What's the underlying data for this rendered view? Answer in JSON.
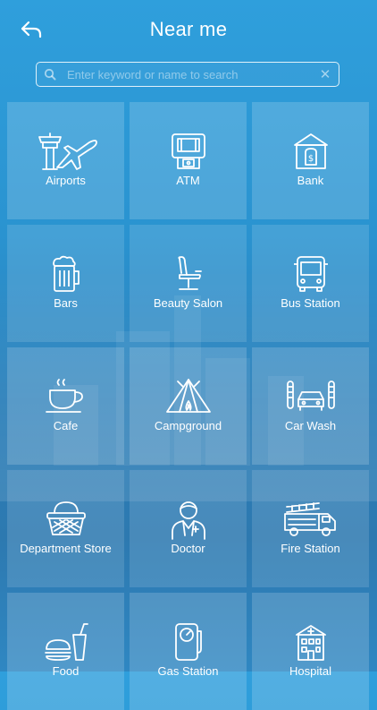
{
  "header": {
    "title": "Near me",
    "back_icon": "back-arrow-icon"
  },
  "search": {
    "placeholder": "Enter keyword or name to search",
    "value": "",
    "search_icon": "search-icon",
    "clear_label": "✕"
  },
  "categories": [
    {
      "label": "Airports",
      "icon": "airport-icon"
    },
    {
      "label": "ATM",
      "icon": "atm-icon"
    },
    {
      "label": "Bank",
      "icon": "bank-icon"
    },
    {
      "label": "Bars",
      "icon": "beer-mug-icon"
    },
    {
      "label": "Beauty Salon",
      "icon": "salon-chair-icon"
    },
    {
      "label": "Bus Station",
      "icon": "bus-icon"
    },
    {
      "label": "Cafe",
      "icon": "coffee-cup-icon"
    },
    {
      "label": "Campground",
      "icon": "tent-icon"
    },
    {
      "label": "Car Wash",
      "icon": "car-wash-icon"
    },
    {
      "label": "Department Store",
      "icon": "basket-icon"
    },
    {
      "label": "Doctor",
      "icon": "doctor-icon"
    },
    {
      "label": "Fire Station",
      "icon": "fire-truck-icon"
    },
    {
      "label": "Food",
      "icon": "fast-food-icon"
    },
    {
      "label": "Gas Station",
      "icon": "gas-pump-icon"
    },
    {
      "label": "Hospital",
      "icon": "hospital-icon"
    }
  ],
  "colors": {
    "background": "#2a8fcc",
    "tile": "rgba(255,255,255,0.17)",
    "text": "#ffffff"
  }
}
